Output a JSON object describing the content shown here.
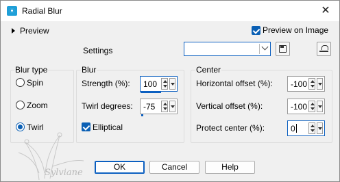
{
  "window": {
    "title": "Radial Blur",
    "close_glyph": "✕"
  },
  "preview": {
    "toggle_label": "Preview",
    "preview_on_image_label": "Preview on Image",
    "preview_on_image_checked": true
  },
  "settings": {
    "label": "Settings",
    "combo_value": ""
  },
  "blur_type": {
    "title": "Blur type",
    "options": [
      {
        "label": "Spin",
        "selected": false
      },
      {
        "label": "Zoom",
        "selected": false
      },
      {
        "label": "Twirl",
        "selected": true
      }
    ]
  },
  "blur": {
    "title": "Blur",
    "strength_label": "Strength (%):",
    "strength_value": "100",
    "twirl_label": "Twirl degrees:",
    "twirl_value": "-75",
    "elliptical_label": "Elliptical",
    "elliptical_checked": true
  },
  "center": {
    "title": "Center",
    "horizontal_label": "Horizontal offset (%):",
    "horizontal_value": "-100",
    "vertical_label": "Vertical offset (%):",
    "vertical_value": "-100",
    "protect_label": "Protect center (%):",
    "protect_value": "0"
  },
  "buttons": {
    "ok": "OK",
    "cancel": "Cancel",
    "help": "Help"
  },
  "watermark": {
    "text": "Sylviane"
  },
  "colors": {
    "accent": "#0b5fc0",
    "app_icon": "#1e9fd8"
  }
}
